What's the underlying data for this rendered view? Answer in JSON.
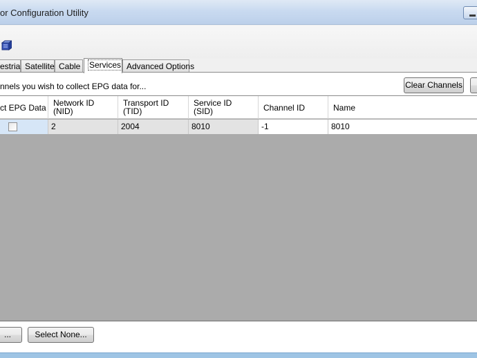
{
  "window": {
    "title": "or Configuration Utility"
  },
  "toolbar": {
    "icon": "database-icon"
  },
  "tabs": [
    {
      "label": "estrial",
      "active": false
    },
    {
      "label": "Satellite",
      "active": false
    },
    {
      "label": "Cable",
      "active": false
    },
    {
      "label": "Services",
      "active": true
    },
    {
      "label": "Advanced Options",
      "active": false
    }
  ],
  "services": {
    "instruction": "nnels you wish to collect EPG data for...",
    "clear_channels_label": "Clear Channels",
    "columns": [
      {
        "line1": "ct EPG Data",
        "line2": ""
      },
      {
        "line1": "Network ID",
        "line2": "(NID)"
      },
      {
        "line1": "Transport ID",
        "line2": "(TID)"
      },
      {
        "line1": "Service ID",
        "line2": "(SID)"
      },
      {
        "line1": "Channel ID",
        "line2": ""
      },
      {
        "line1": "Name",
        "line2": ""
      }
    ],
    "rows": [
      {
        "collect": false,
        "nid": "2",
        "tid": "2004",
        "sid": "8010",
        "channel_id": "-1",
        "name": "8010"
      }
    ],
    "select_all_label": "...",
    "select_none_label": "Select None..."
  }
}
